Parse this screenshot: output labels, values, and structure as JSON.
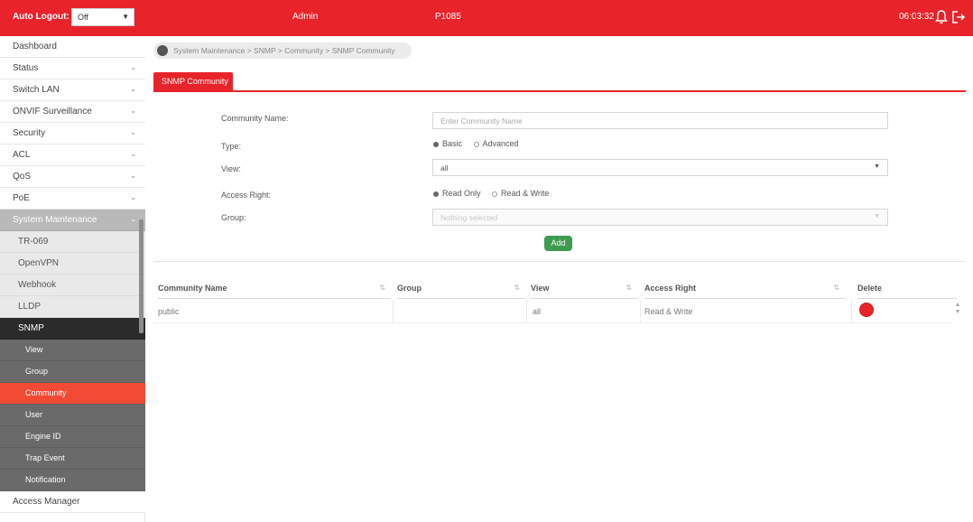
{
  "topbar": {
    "auto_logout_label": "Auto Logout:",
    "auto_logout_value": "Off",
    "user": "Admin",
    "model": "P1085",
    "clock": "06:03:32"
  },
  "sidebar": {
    "items": [
      {
        "label": "Dashboard"
      },
      {
        "label": "Status"
      },
      {
        "label": "Switch LAN"
      },
      {
        "label": "ONVIF Surveillance"
      },
      {
        "label": "Security"
      },
      {
        "label": "ACL"
      },
      {
        "label": "QoS"
      },
      {
        "label": "PoE"
      },
      {
        "label": "System Maintenance"
      },
      {
        "label": "TR-069"
      },
      {
        "label": "OpenVPN"
      },
      {
        "label": "Webhook"
      },
      {
        "label": "LLDP"
      },
      {
        "label": "SNMP"
      },
      {
        "label": "View"
      },
      {
        "label": "Group"
      },
      {
        "label": "Community"
      },
      {
        "label": "User"
      },
      {
        "label": "Engine ID"
      },
      {
        "label": "Trap Event"
      },
      {
        "label": "Notification"
      },
      {
        "label": "Access Manager"
      }
    ]
  },
  "breadcrumb": "System Maintenance > SNMP > Community > SNMP Community",
  "tab": "SNMP Community",
  "form": {
    "community_name_label": "Community Name:",
    "community_name_placeholder": "Enter Community Name",
    "type_label": "Type:",
    "type_basic": "Basic",
    "type_advanced": "Advanced",
    "view_label": "View:",
    "view_value": "all",
    "access_right_label": "Access Right:",
    "access_read_only": "Read Only",
    "access_read_write": "Read & Write",
    "group_label": "Group:",
    "group_placeholder": "Nothing selected",
    "add_label": "Add"
  },
  "table": {
    "headers": [
      "Community Name",
      "Group",
      "View",
      "Access Right",
      "Delete"
    ],
    "rows": [
      {
        "community_name": "public",
        "group": "",
        "view": "all",
        "access_right": "Read & Write"
      }
    ]
  },
  "colors": {
    "brand": "#e8232a",
    "current_menu": "#f14a35",
    "add_button": "#3e9c50"
  }
}
